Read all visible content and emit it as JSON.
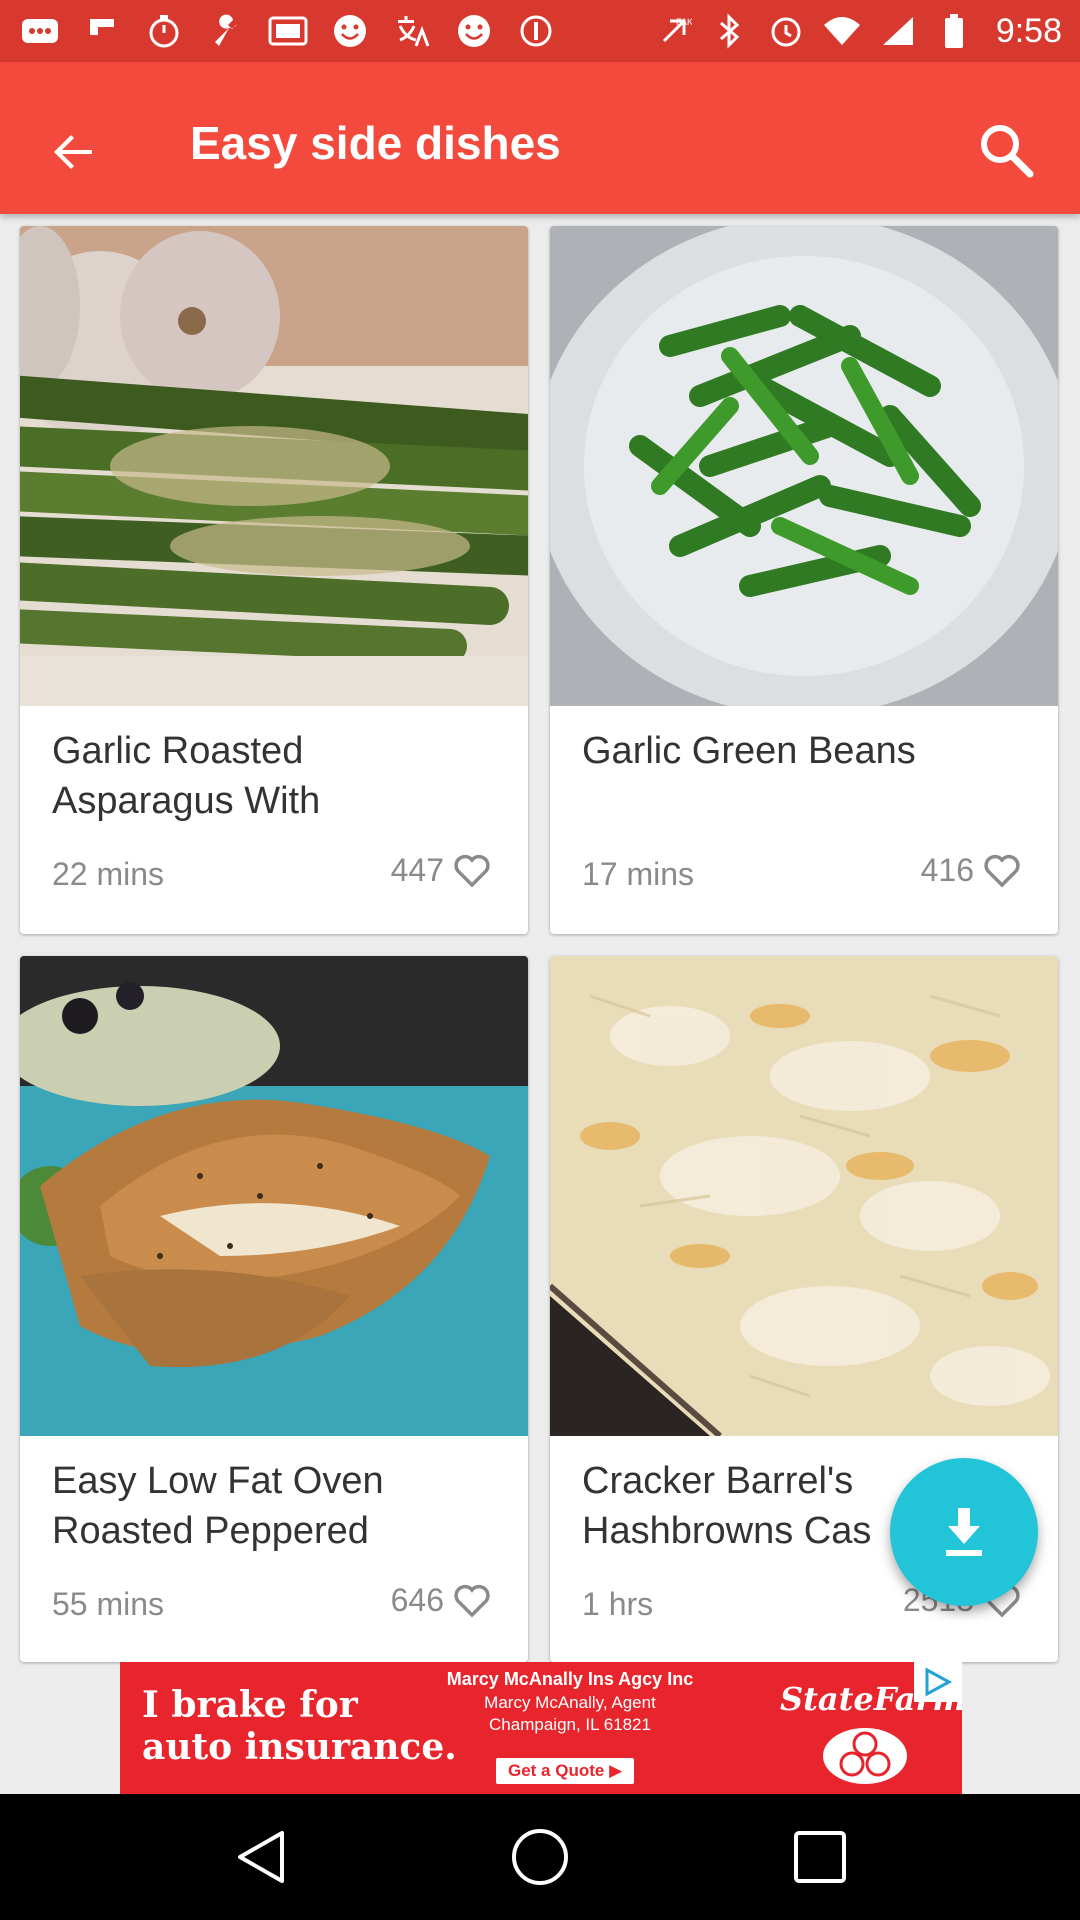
{
  "status_bar": {
    "time": "9:58",
    "icons": [
      "messages-icon",
      "flipboard-icon",
      "stopwatch-icon",
      "wrench-icon",
      "gallery-icon",
      "smiley-icon",
      "translate-icon",
      "smiley-icon",
      "leaf-icon",
      "data-icon",
      "bluetooth-icon",
      "alarm-icon",
      "wifi-icon",
      "signal-icon",
      "battery-icon"
    ]
  },
  "app_bar": {
    "title": "Easy side dishes",
    "back_icon": "arrow-back-icon",
    "search_icon": "search-icon"
  },
  "colors": {
    "app_bar": "#f44a3e",
    "status_bar": "#d8392f",
    "fab": "#22c4d8",
    "ad_red": "#e8252c"
  },
  "recipes": [
    {
      "name": "Garlic Roasted Asparagus With",
      "time": "22 mins",
      "likes": "447"
    },
    {
      "name": "Garlic Green Beans",
      "time": "17 mins",
      "likes": "416"
    },
    {
      "name": "Easy Low Fat Oven Roasted Peppered",
      "time": "55 mins",
      "likes": "646"
    },
    {
      "name": "Cracker Barrel's Hashbrowns Cas",
      "time": "1 hrs",
      "likes": "2513"
    }
  ],
  "fab": {
    "icon": "download-icon"
  },
  "ad": {
    "headline_1": "I brake for",
    "headline_2": "auto insurance.",
    "agency": "Marcy McAnally Ins Agcy Inc",
    "agent": "Marcy McAnally, Agent",
    "location": "Champaign, IL 61821",
    "cta": "Get a Quote ▶",
    "brand": "StateFarm"
  },
  "nav_bar": {
    "icons": [
      "back-triangle-icon",
      "home-circle-icon",
      "recents-square-icon"
    ]
  }
}
